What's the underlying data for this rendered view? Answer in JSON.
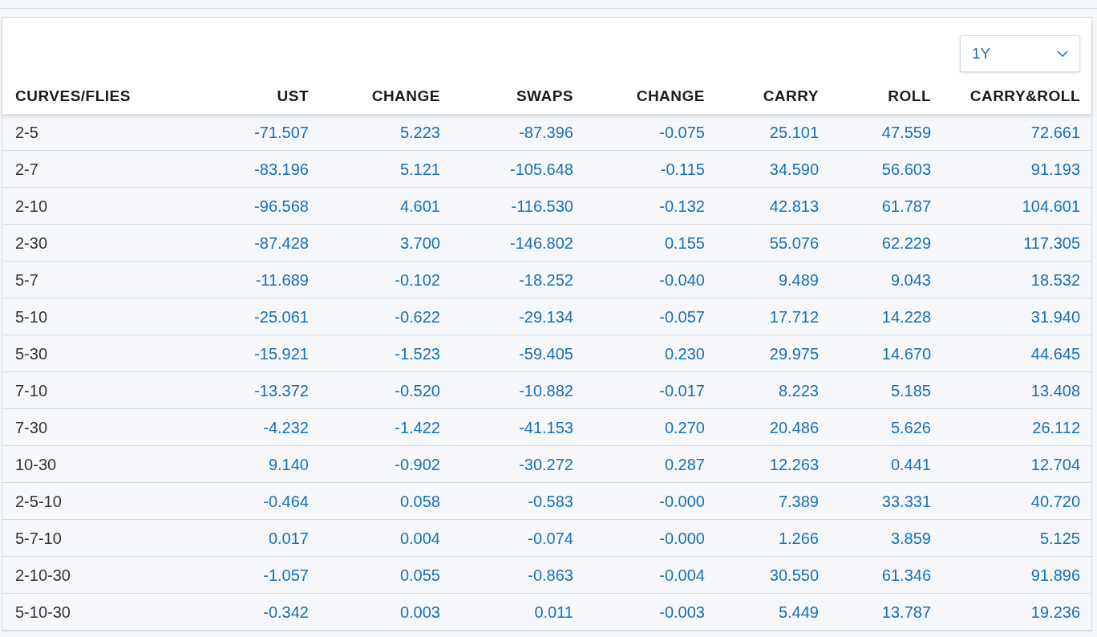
{
  "period_select": {
    "value": "1Y"
  },
  "table": {
    "columns": [
      "CURVES/FLIES",
      "UST",
      "CHANGE",
      "SWAPS",
      "CHANGE",
      "CARRY",
      "ROLL",
      "CARRY&ROLL"
    ],
    "rows": [
      [
        "2-5",
        "-71.507",
        "5.223",
        "-87.396",
        "-0.075",
        "25.101",
        "47.559",
        "72.661"
      ],
      [
        "2-7",
        "-83.196",
        "5.121",
        "-105.648",
        "-0.115",
        "34.590",
        "56.603",
        "91.193"
      ],
      [
        "2-10",
        "-96.568",
        "4.601",
        "-116.530",
        "-0.132",
        "42.813",
        "61.787",
        "104.601"
      ],
      [
        "2-30",
        "-87.428",
        "3.700",
        "-146.802",
        "0.155",
        "55.076",
        "62.229",
        "117.305"
      ],
      [
        "5-7",
        "-11.689",
        "-0.102",
        "-18.252",
        "-0.040",
        "9.489",
        "9.043",
        "18.532"
      ],
      [
        "5-10",
        "-25.061",
        "-0.622",
        "-29.134",
        "-0.057",
        "17.712",
        "14.228",
        "31.940"
      ],
      [
        "5-30",
        "-15.921",
        "-1.523",
        "-59.405",
        "0.230",
        "29.975",
        "14.670",
        "44.645"
      ],
      [
        "7-10",
        "-13.372",
        "-0.520",
        "-10.882",
        "-0.017",
        "8.223",
        "5.185",
        "13.408"
      ],
      [
        "7-30",
        "-4.232",
        "-1.422",
        "-41.153",
        "0.270",
        "20.486",
        "5.626",
        "26.112"
      ],
      [
        "10-30",
        "9.140",
        "-0.902",
        "-30.272",
        "0.287",
        "12.263",
        "0.441",
        "12.704"
      ],
      [
        "2-5-10",
        "-0.464",
        "0.058",
        "-0.583",
        "-0.000",
        "7.389",
        "33.331",
        "40.720"
      ],
      [
        "5-7-10",
        "0.017",
        "0.004",
        "-0.074",
        "-0.000",
        "1.266",
        "3.859",
        "5.125"
      ],
      [
        "2-10-30",
        "-1.057",
        "0.055",
        "-0.863",
        "-0.004",
        "30.550",
        "61.346",
        "91.896"
      ],
      [
        "5-10-30",
        "-0.342",
        "0.003",
        "0.011",
        "-0.003",
        "5.449",
        "13.787",
        "19.236"
      ]
    ]
  }
}
